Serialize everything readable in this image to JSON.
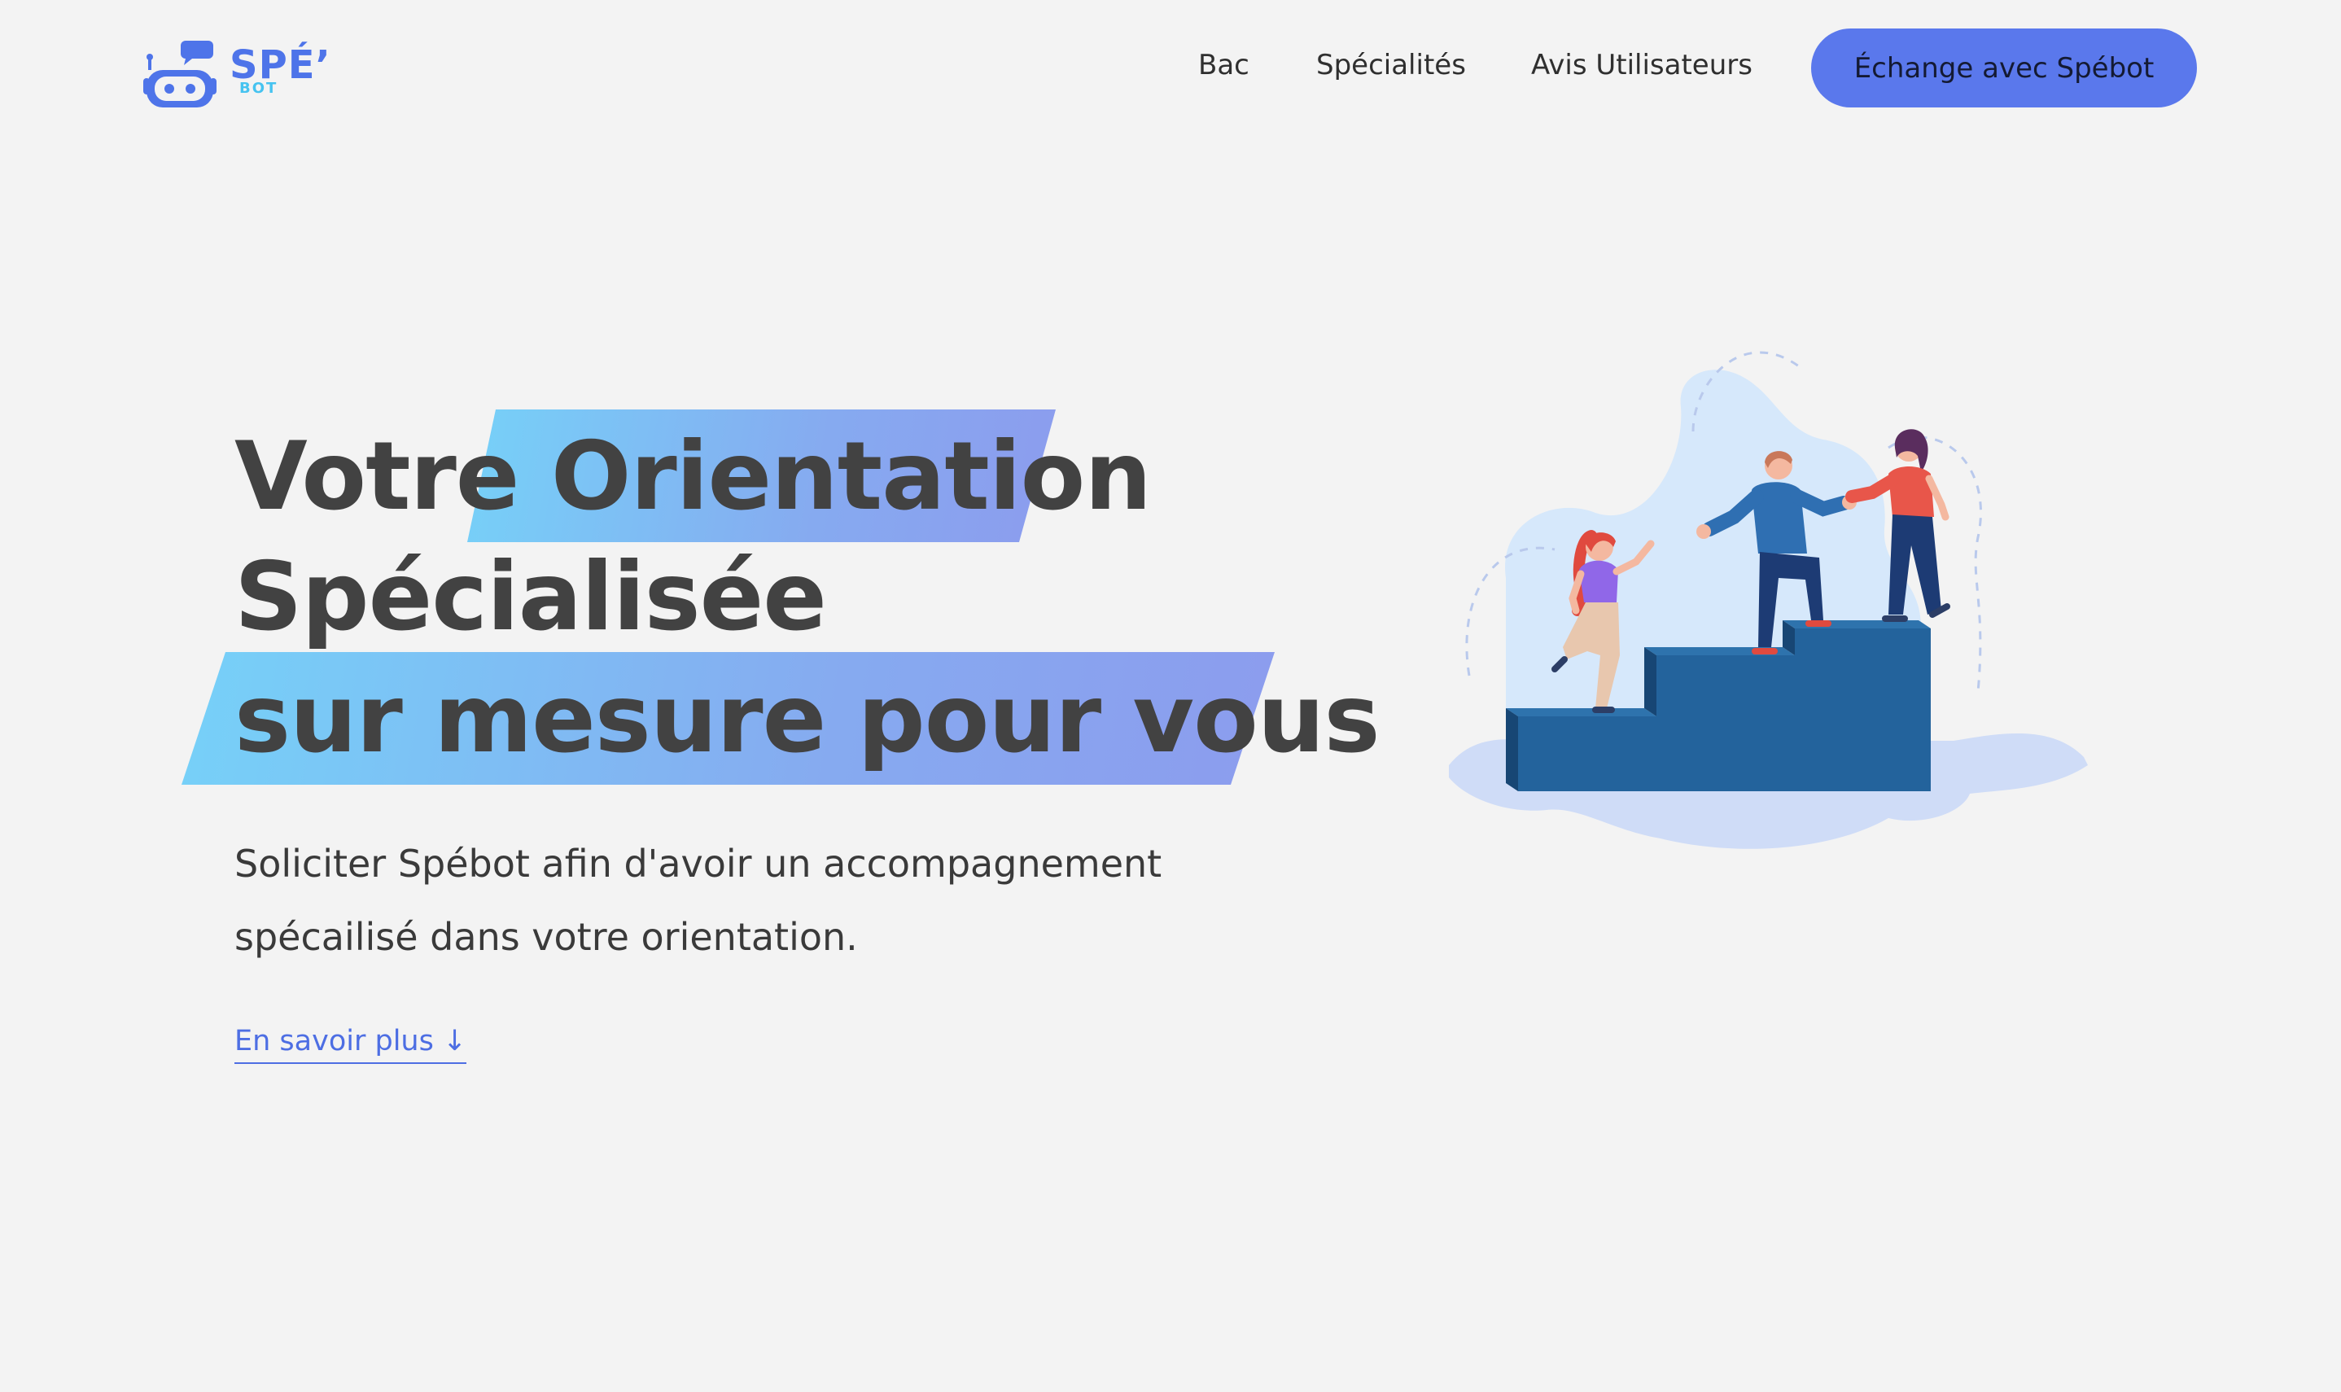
{
  "header": {
    "logo": {
      "brand": "SPÉ’",
      "tag": "BOT"
    },
    "nav": [
      {
        "label": "Bac"
      },
      {
        "label": "Spécialités"
      },
      {
        "label": "Avis Utilisateurs"
      }
    ],
    "cta_label": "Échange avec Spébot"
  },
  "hero": {
    "title_line1_plain": "Votre",
    "title_line1_highlight": "Orientation",
    "title_line2": "Spécialisée",
    "title_line3": "sur mesure pour vous",
    "subtitle_line1": "Soliciter Spébot afin d'avoir un accompagnement",
    "subtitle_line2": "spécailisé dans votre orientation.",
    "learn_more": "En savoir plus ↓"
  },
  "colors": {
    "background": "#f3f3f3",
    "accent": "#5a78ec",
    "link": "#4d6ee3",
    "stairs": "#23639c",
    "highlight_gradient": [
      "#76d1f8",
      "#8c9cee"
    ]
  },
  "icons": [
    "robot-logo-icon",
    "down-arrow-icon"
  ]
}
